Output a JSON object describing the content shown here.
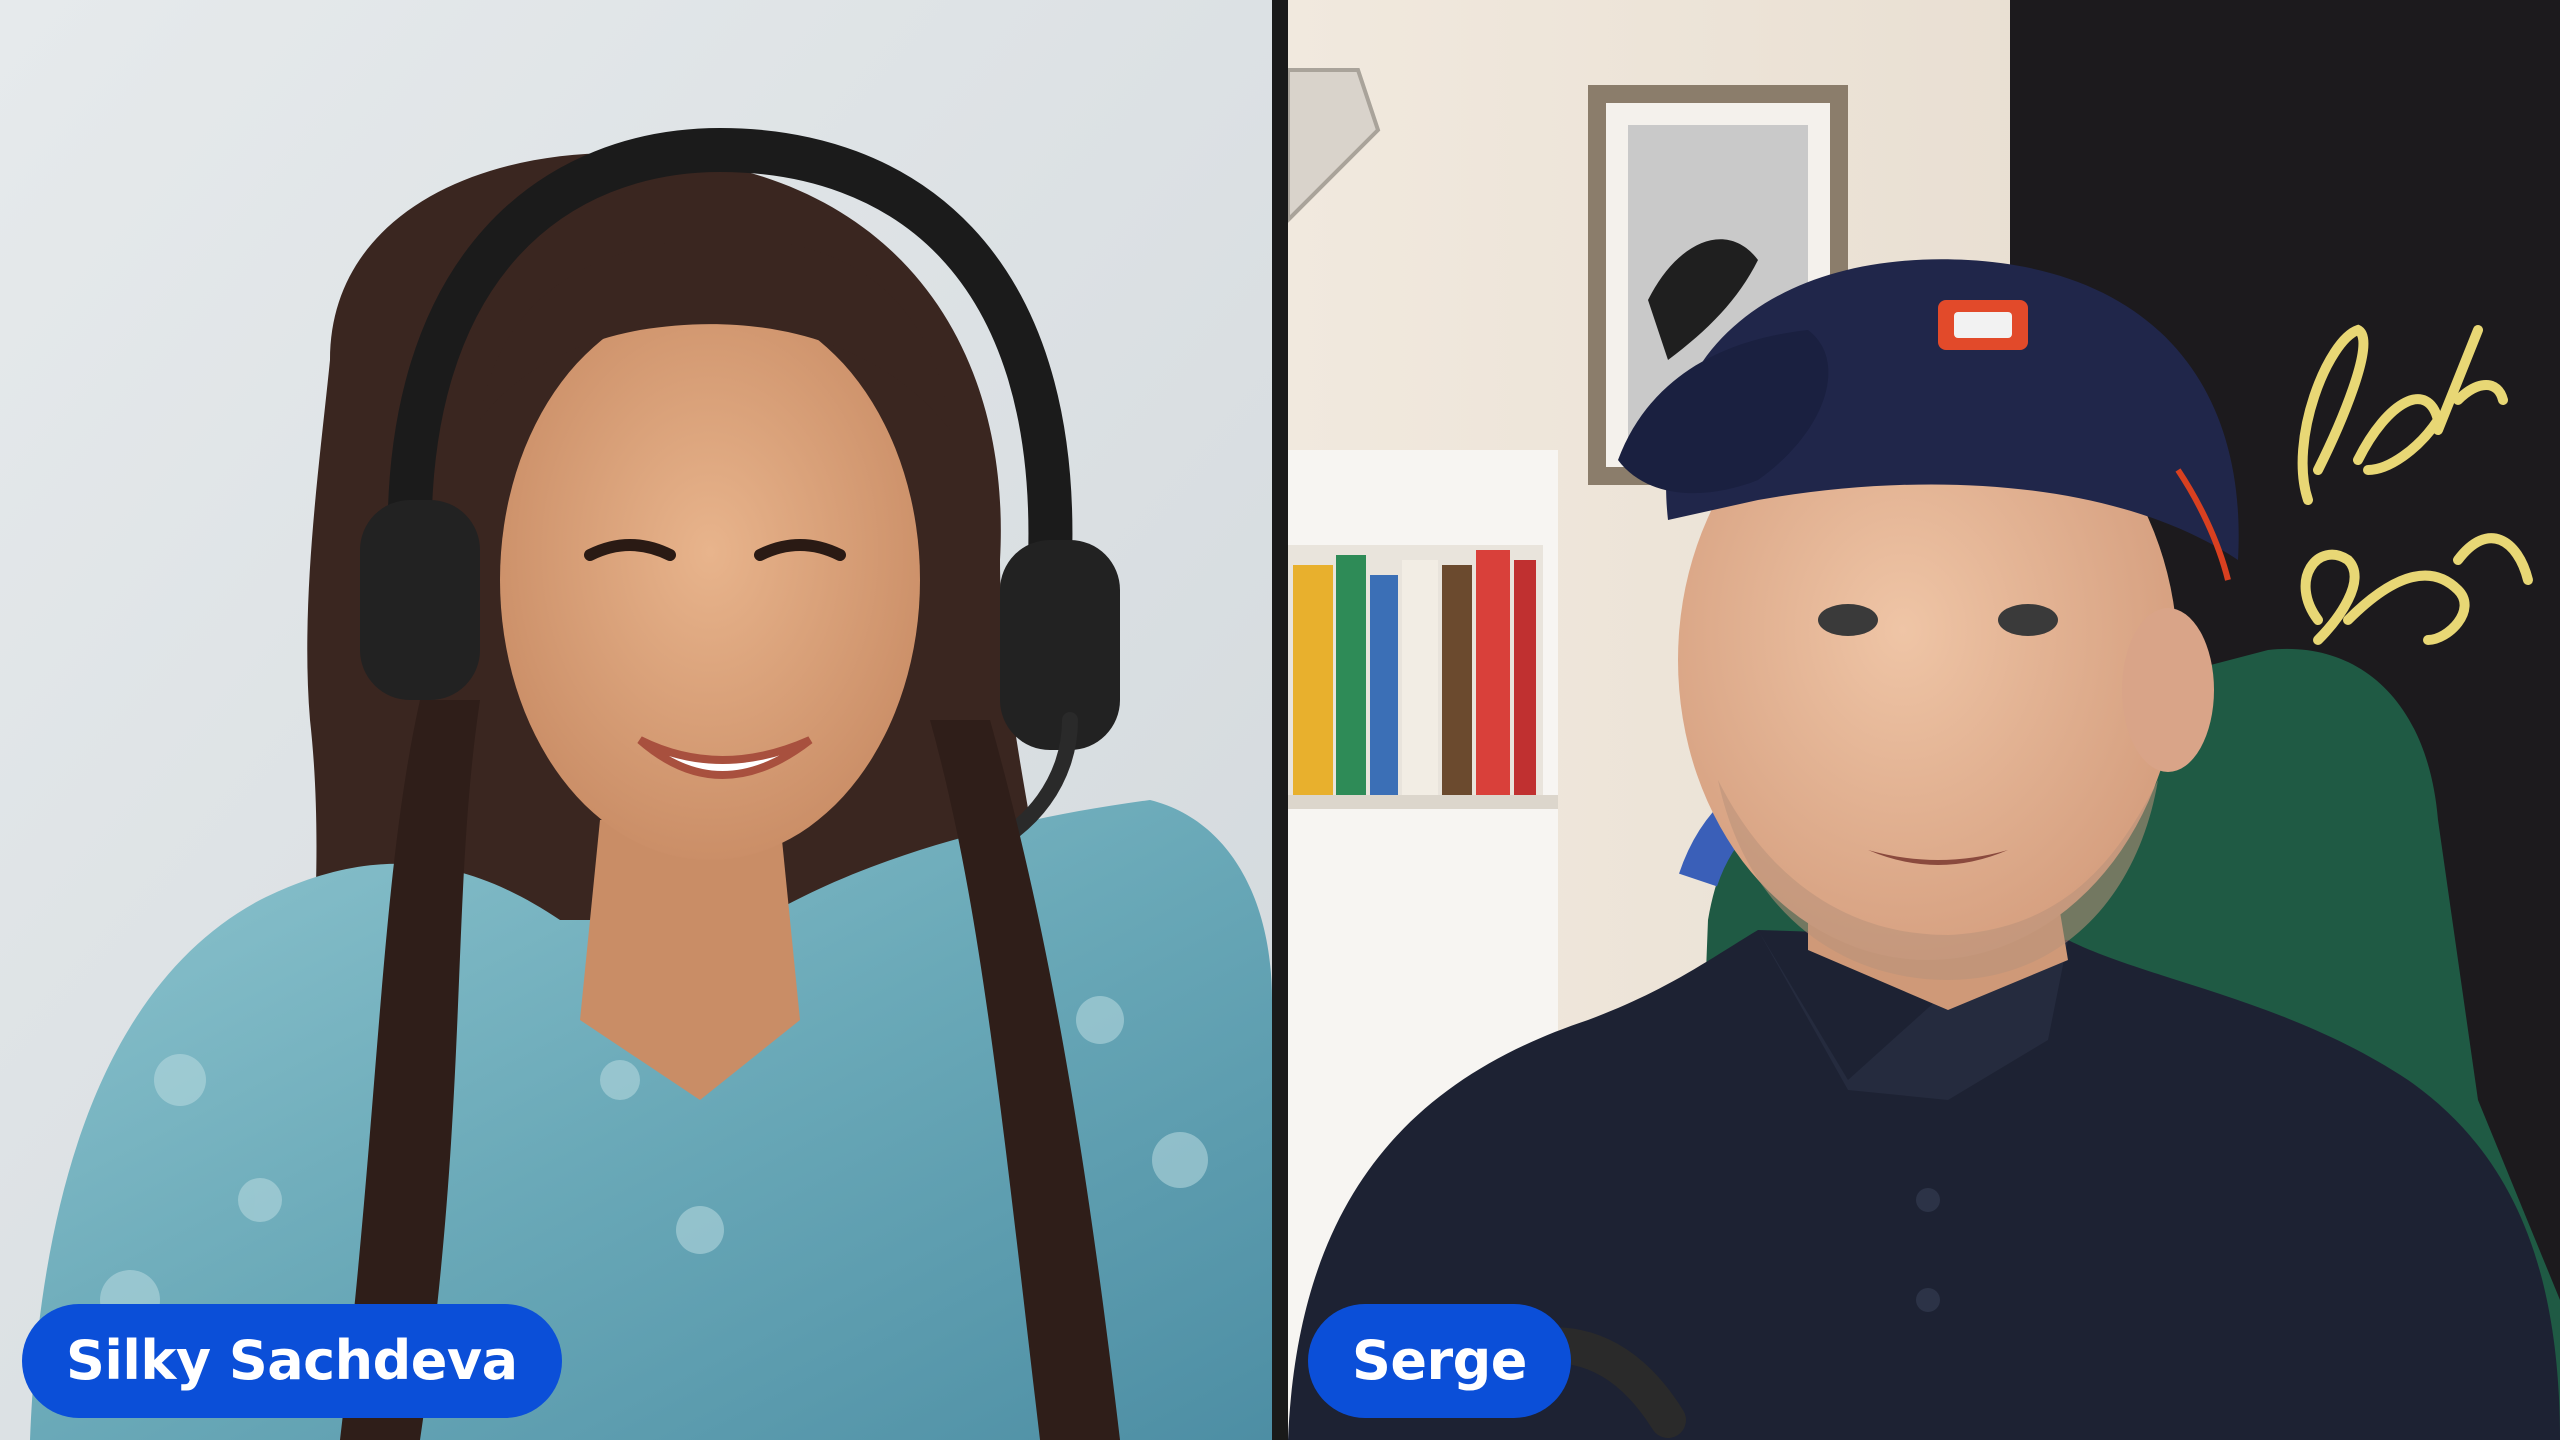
{
  "call": {
    "layout": "two-up video grid",
    "participants": [
      {
        "name": "Silky Sachdeva",
        "tag_color": "#0b4fd8"
      },
      {
        "name": "Serge",
        "tag_color": "#0b4fd8"
      }
    ]
  },
  "scenes": {
    "left": {
      "background": "#dfe3e6",
      "description_icon": "person-with-headset"
    },
    "right": {
      "background": "#efe7dc",
      "neon_sign_icon": "neon-sign"
    }
  },
  "colors": {
    "stage_bg": "#141414",
    "name_tag_bg": "#0b4fd8",
    "name_tag_text": "#ffffff"
  }
}
